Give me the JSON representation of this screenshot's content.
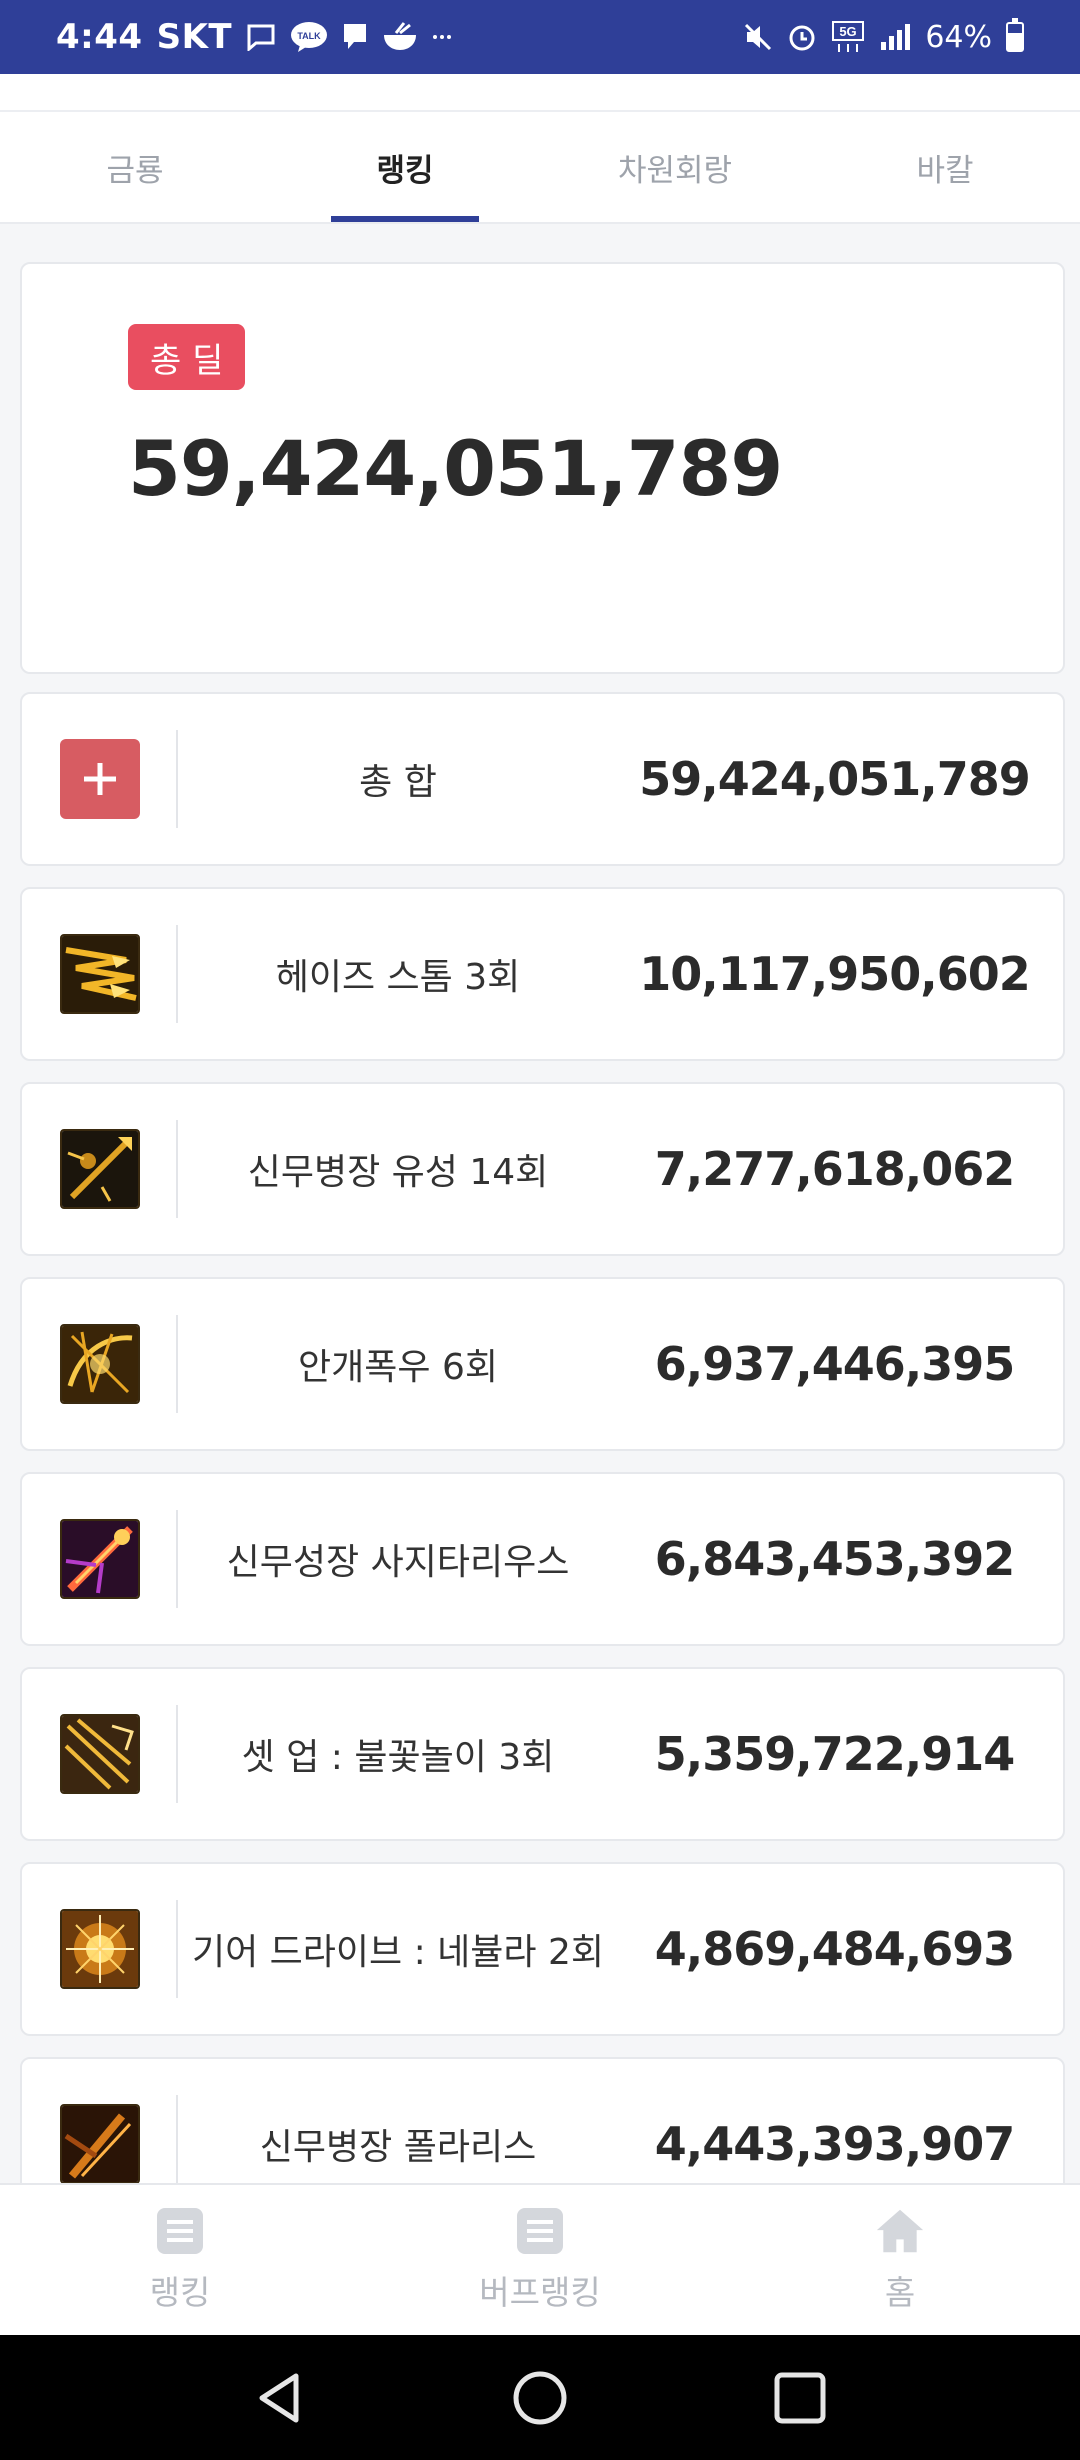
{
  "status_bar": {
    "time": "4:44",
    "carrier": "SKT",
    "battery": "64%",
    "battery_level": 0.64,
    "network": "5G"
  },
  "tabs": [
    {
      "label": "금룡",
      "active": false
    },
    {
      "label": "랭킹",
      "active": true
    },
    {
      "label": "차원회랑",
      "active": false
    },
    {
      "label": "바칼",
      "active": false
    }
  ],
  "total": {
    "badge": "총 딜",
    "value": "59,424,051,789"
  },
  "rows": [
    {
      "label": "총 합",
      "value": "59,424,051,789",
      "icon": "plus-icon"
    },
    {
      "label": "헤이즈 스톰 3회",
      "value": "10,117,950,602",
      "icon": "haze-storm-icon"
    },
    {
      "label": "신무병장 유성 14회",
      "value": "7,277,618,062",
      "icon": "meteor-spear-icon"
    },
    {
      "label": "안개폭우 6회",
      "value": "6,937,446,395",
      "icon": "mist-rain-icon"
    },
    {
      "label": "신무성장 사지타리우스",
      "value": "6,843,453,392",
      "icon": "sagittarius-icon"
    },
    {
      "label": "셋 업 : 불꽃놀이 3회",
      "value": "5,359,722,914",
      "icon": "fireworks-icon"
    },
    {
      "label": "기어 드라이브 : 네뷸라 2회",
      "value": "4,869,484,693",
      "icon": "nebula-icon"
    },
    {
      "label": "신무병장 폴라리스",
      "value": "4,443,393,907",
      "icon": "polaris-icon"
    }
  ],
  "bottom_nav": [
    {
      "label": "랭킹",
      "icon": "list-icon"
    },
    {
      "label": "버프랭킹",
      "icon": "list-icon"
    },
    {
      "label": "홈",
      "icon": "home-icon"
    }
  ],
  "colors": {
    "status_bar": "#2f3f98",
    "badge": "#e94e60",
    "plus_icon": "#d75c62",
    "tab_indicator": "#2f3f98"
  }
}
